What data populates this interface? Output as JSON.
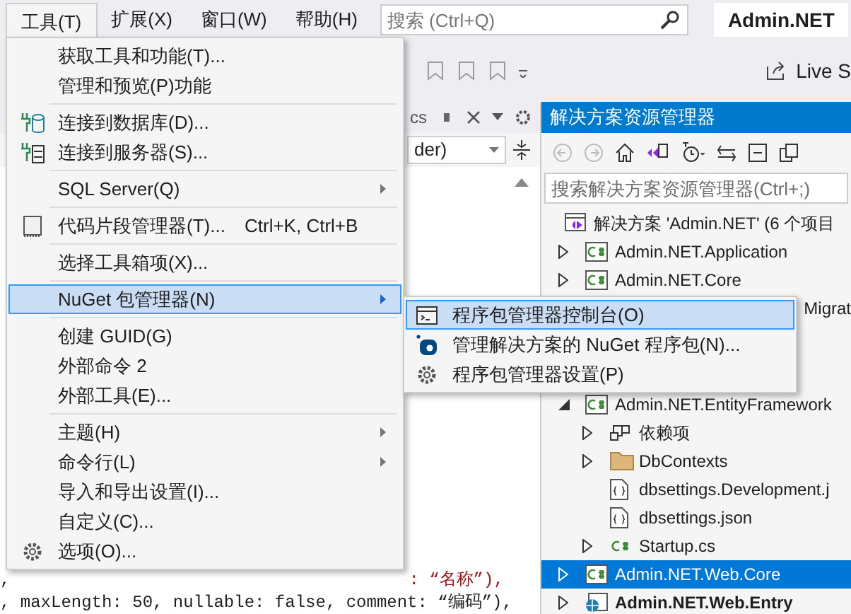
{
  "menu_bar": {
    "items": [
      {
        "label": "工具(T)",
        "selected": true
      },
      {
        "label": "扩展(X)",
        "selected": false
      },
      {
        "label": "窗口(W)",
        "selected": false
      },
      {
        "label": "帮助(H)",
        "selected": false
      }
    ],
    "search": {
      "placeholder": "搜索 (Ctrl+Q)"
    },
    "solution_badge": "Admin.NET"
  },
  "toolbar": {
    "live_share": "Live S"
  },
  "editor": {
    "tab_label": "cs",
    "dropdown_value": "der)",
    "code_lines": [
      {
        "left": ",",
        "right": ": “名称”),"
      },
      {
        "left": ", maxLength: 50, nullable: false, comment: “编码”),"
      }
    ]
  },
  "tools_menu": {
    "items": [
      {
        "kind": "item",
        "label": "获取工具和功能(T)...",
        "submenu": false,
        "selected": false
      },
      {
        "kind": "item",
        "label": "管理和预览(P)功能",
        "submenu": false,
        "selected": false
      },
      {
        "kind": "separator"
      },
      {
        "kind": "item",
        "label": "连接到数据库(D)...",
        "submenu": false,
        "selected": false
      },
      {
        "kind": "item",
        "label": "连接到服务器(S)...",
        "submenu": false,
        "selected": false
      },
      {
        "kind": "separator"
      },
      {
        "kind": "item",
        "label": "SQL Server(Q)",
        "submenu": true,
        "selected": false
      },
      {
        "kind": "separator"
      },
      {
        "kind": "item",
        "label": "代码片段管理器(T)...",
        "shortcut": "Ctrl+K, Ctrl+B",
        "submenu": false,
        "selected": false
      },
      {
        "kind": "separator"
      },
      {
        "kind": "item",
        "label": "选择工具箱项(X)...",
        "submenu": false,
        "selected": false
      },
      {
        "kind": "separator"
      },
      {
        "kind": "item",
        "label": "NuGet 包管理器(N)",
        "submenu": true,
        "selected": true
      },
      {
        "kind": "separator"
      },
      {
        "kind": "item",
        "label": "创建 GUID(G)",
        "submenu": false,
        "selected": false
      },
      {
        "kind": "item",
        "label": "外部命令 2",
        "submenu": false,
        "selected": false
      },
      {
        "kind": "item",
        "label": "外部工具(E)...",
        "submenu": false,
        "selected": false
      },
      {
        "kind": "separator"
      },
      {
        "kind": "item",
        "label": "主题(H)",
        "submenu": true,
        "selected": false
      },
      {
        "kind": "item",
        "label": "命令行(L)",
        "submenu": true,
        "selected": false
      },
      {
        "kind": "item",
        "label": "导入和导出设置(I)...",
        "submenu": false,
        "selected": false
      },
      {
        "kind": "item",
        "label": "自定义(C)...",
        "submenu": false,
        "selected": false
      },
      {
        "kind": "item",
        "label": "选项(O)...",
        "submenu": false,
        "selected": false
      }
    ]
  },
  "nuget_submenu": {
    "items": [
      {
        "label": "程序包管理器控制台(O)",
        "selected": true
      },
      {
        "label": "管理解决方案的 NuGet 程序包(N)...",
        "selected": false
      },
      {
        "label": "程序包管理器设置(P)",
        "selected": false
      }
    ]
  },
  "solution_explorer": {
    "title": "解决方案资源管理器",
    "search": {
      "placeholder": "搜索解决方案资源管理器(Ctrl+;)"
    },
    "tree": [
      {
        "label": "解决方案 'Admin.NET' (6 个项目",
        "kind": "solution",
        "selected": false,
        "children": [
          {
            "label": "Admin.NET.Application",
            "kind": "project",
            "expanded": false,
            "selected": false
          },
          {
            "label": "Admin.NET.Core",
            "kind": "project",
            "expanded": false,
            "selected": false
          },
          {
            "label": "Migrat",
            "kind": "partial"
          },
          {
            "label": "Admin.NET.EntityFramework",
            "kind": "project",
            "expanded": true,
            "selected": false,
            "children": [
              {
                "label": "依赖项",
                "kind": "dependencies",
                "expanded": false,
                "selected": false
              },
              {
                "label": "DbContexts",
                "kind": "folder",
                "expanded": false,
                "selected": false
              },
              {
                "label": "dbsettings.Development.j",
                "kind": "json_file",
                "selected": false
              },
              {
                "label": "dbsettings.json",
                "kind": "json_file",
                "selected": false
              },
              {
                "label": "Startup.cs",
                "kind": "cs_file",
                "expanded": false,
                "selected": false
              }
            ]
          },
          {
            "label": "Admin.NET.Web.Core",
            "kind": "project",
            "expanded": false,
            "selected": true
          },
          {
            "label": "Admin.NET.Web.Entry",
            "kind": "web_project",
            "expanded": false,
            "selected": false
          }
        ]
      }
    ]
  }
}
